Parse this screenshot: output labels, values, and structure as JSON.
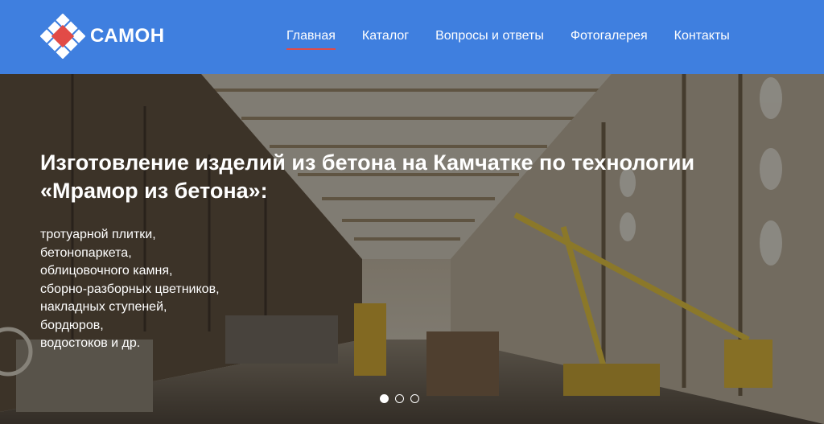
{
  "brand": {
    "name": "САМОН",
    "logo_letter": "С"
  },
  "nav": {
    "items": [
      {
        "label": "Главная",
        "active": true
      },
      {
        "label": "Каталог",
        "active": false
      },
      {
        "label": "Вопросы и ответы",
        "active": false
      },
      {
        "label": "Фотогалерея",
        "active": false
      },
      {
        "label": "Контакты",
        "active": false
      }
    ]
  },
  "hero": {
    "title_line1": "Изготовление изделий из бетона на Камчатке по технологии",
    "title_line2": "«Мрамор из бетона»:",
    "items": [
      "тротуарной плитки,",
      "бетонопаркета,",
      "облицовочного камня,",
      "сборно-разборных цветников,",
      "накладных ступеней,",
      "бордюров,",
      "водостоков и др."
    ],
    "image": "factory-hall-photo",
    "slides": {
      "count": 3,
      "active": 1
    }
  },
  "colors": {
    "header": "#3f7fdf",
    "accent": "#e24b47"
  }
}
